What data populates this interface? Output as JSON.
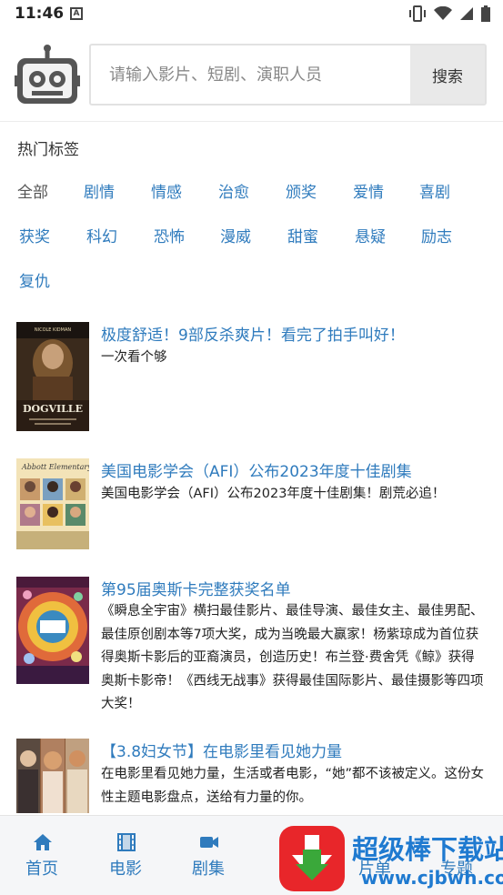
{
  "status_bar": {
    "time": "11:46",
    "notif_letter": "A"
  },
  "search": {
    "placeholder": "请输入影片、短剧、演职人员",
    "button_label": "搜索"
  },
  "tags": {
    "title": "热门标签",
    "items": [
      "全部",
      "剧情",
      "情感",
      "治愈",
      "颁奖",
      "爱情",
      "喜剧",
      "获奖",
      "科幻",
      "恐怖",
      "漫威",
      "甜蜜",
      "悬疑",
      "励志",
      "复仇"
    ]
  },
  "articles": [
    {
      "title": "极度舒适！9部反杀爽片！看完了拍手叫好！",
      "desc": "一次看个够",
      "poster_text": "DOGVILLE",
      "poster_top": "NICOLE KIDMAN"
    },
    {
      "title": "美国电影学会（AFI）公布2023年度十佳剧集",
      "desc": "美国电影学会（AFI）公布2023年度十佳剧集！剧荒必追！",
      "poster_text": "Abbott Elementary"
    },
    {
      "title": "第95届奥斯卡完整获奖名单",
      "desc": "《瞬息全宇宙》横扫最佳影片、最佳导演、最佳女主、最佳男配、最佳原创剧本等7项大奖，成为当晚最大赢家！杨紫琼成为首位获得奥斯卡影后的亚裔演员，创造历史！布兰登·费舍凭《鲸》获得奥斯卡影帝！《西线无战事》获得最佳国际影片、最佳摄影等四项大奖！"
    },
    {
      "title": "【3.8妇女节】在电影里看见她力量",
      "desc": "在电影里看见她力量，生活或者电影，“她”都不该被定义。这份女性主题电影盘点，送给有力量的你。"
    }
  ],
  "tabbar": {
    "items": [
      "首页",
      "电影",
      "剧集",
      "片单",
      "专题"
    ]
  },
  "watermark": {
    "line1": "超级棒下载站",
    "line2": "www.cjbwh.com"
  },
  "colors": {
    "accent": "#2f7bbd",
    "tabbar_bg": "#f5f6f8"
  }
}
